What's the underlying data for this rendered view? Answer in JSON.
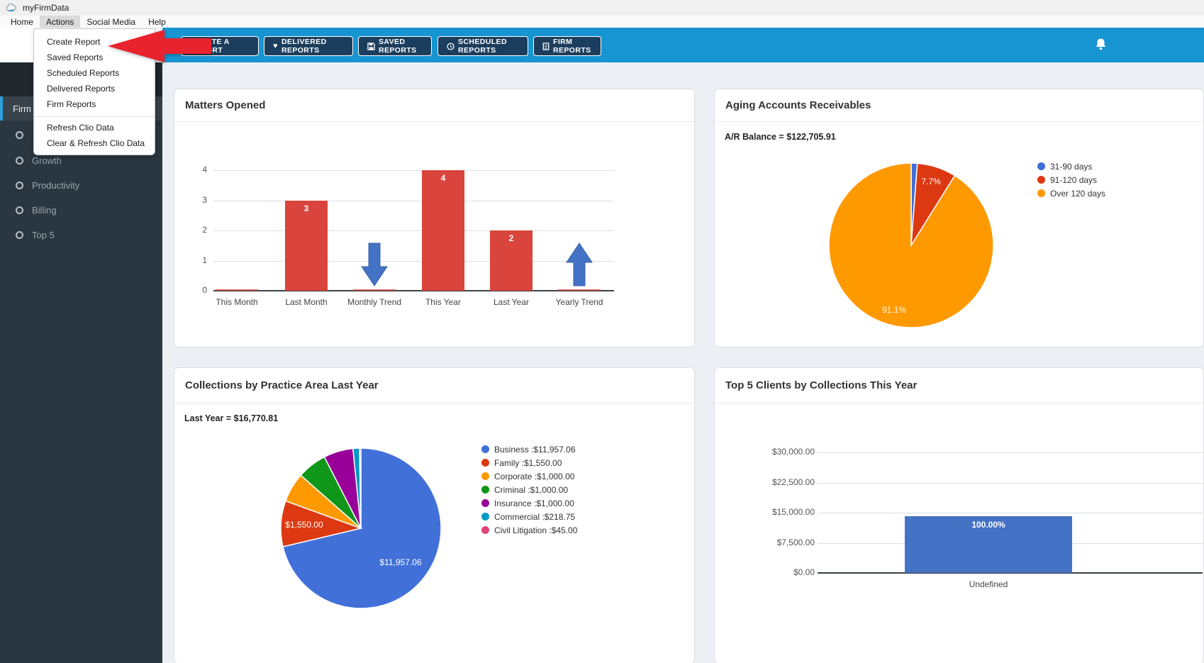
{
  "window": {
    "title": "myFirmData"
  },
  "menubar": {
    "items": [
      "Home",
      "Actions",
      "Social Media",
      "Help"
    ],
    "active": "Actions"
  },
  "actions_menu": {
    "primary": [
      "Create Report",
      "Saved Reports",
      "Scheduled Reports",
      "Delivered Reports",
      "Firm Reports"
    ],
    "secondary": [
      "Refresh Clio Data",
      "Clear & Refresh Clio Data"
    ]
  },
  "toolbar": {
    "buttons": [
      {
        "icon": "",
        "label": "CREATE A REPORT"
      },
      {
        "icon": "heart",
        "label": "DELIVERED REPORTS"
      },
      {
        "icon": "save",
        "label": "SAVED REPORTS"
      },
      {
        "icon": "clock",
        "label": "SCHEDULED REPORTS"
      },
      {
        "icon": "report",
        "label": "FIRM REPORTS"
      }
    ]
  },
  "sidebar": {
    "section": "Firm",
    "items": [
      {
        "label": ""
      },
      {
        "label": "Growth"
      },
      {
        "label": "Productivity"
      },
      {
        "label": "Billing"
      },
      {
        "label": "Top 5"
      }
    ]
  },
  "cards": {
    "matters": {
      "title": "Matters Opened"
    },
    "aging": {
      "title": "Aging Accounts Receivables",
      "subtitle": "A/R Balance = $122,705.91"
    },
    "collections": {
      "title": "Collections by Practice Area Last Year",
      "subtitle": "Last Year = $16,770.81"
    },
    "top5": {
      "title": "Top 5 Clients by Collections This Year"
    }
  },
  "colors": {
    "toolbar_blue": "#1795d2",
    "button_navy": "#1c3e5e",
    "bar_red": "#d9453c",
    "trend_arrow_blue": "#4472c4",
    "sidebar_accent": "#2d9ed8"
  },
  "chart_data": [
    {
      "id": "matters_opened",
      "type": "bar",
      "title": "Matters Opened",
      "categories": [
        "This Month",
        "Last Month",
        "Monthly Trend",
        "This Year",
        "Last Year",
        "Yearly Trend"
      ],
      "values": [
        0,
        3,
        null,
        4,
        2,
        null
      ],
      "bar_labels": [
        "",
        "3",
        "",
        "4",
        "2",
        ""
      ],
      "trend_markers": [
        {
          "category": "Monthly Trend",
          "direction": "down"
        },
        {
          "category": "Yearly Trend",
          "direction": "up"
        }
      ],
      "yticks": [
        0,
        1,
        2,
        3,
        4
      ],
      "ylim": [
        0,
        4
      ],
      "grid": true,
      "bar_color": "#d9453c",
      "arrow_color": "#4472c4",
      "legend_position": "none"
    },
    {
      "id": "aging_accounts_receivables",
      "type": "pie",
      "title": "Aging Accounts Receivables",
      "subtitle": "A/R Balance = $122,705.91",
      "start_angle_deg": 0,
      "direction": "clockwise",
      "legend_position": "right",
      "slices": [
        {
          "label": "31-90 days",
          "percent": 1.2,
          "color": "#3f6ed8",
          "data_label": ""
        },
        {
          "label": "91-120 days",
          "percent": 7.7,
          "color": "#dc3912",
          "data_label": "7.7%"
        },
        {
          "label": "Over 120 days",
          "percent": 91.1,
          "color": "#ff9900",
          "data_label": "91.1%"
        }
      ]
    },
    {
      "id": "collections_by_practice_area",
      "type": "pie",
      "title": "Collections by Practice Area Last Year",
      "subtitle": "Last Year = $16,770.81",
      "total": 16770.81,
      "start_angle_deg": 0,
      "direction": "clockwise",
      "legend_position": "right",
      "slices": [
        {
          "label": "Business",
          "value": 11957.06,
          "percent": 71.3,
          "color": "#4170d8",
          "data_label": "$11,957.06"
        },
        {
          "label": "Family",
          "value": 1550.0,
          "percent": 9.24,
          "color": "#dc3912",
          "data_label": "$1,550.00"
        },
        {
          "label": "Corporate",
          "value": 1000.0,
          "percent": 5.96,
          "color": "#ff9900",
          "data_label": ""
        },
        {
          "label": "Criminal",
          "value": 1000.0,
          "percent": 5.96,
          "color": "#109618",
          "data_label": ""
        },
        {
          "label": "Insurance",
          "value": 1000.0,
          "percent": 5.96,
          "color": "#990099",
          "data_label": ""
        },
        {
          "label": "Commercial",
          "value": 218.75,
          "percent": 1.3,
          "color": "#0099c6",
          "data_label": ""
        },
        {
          "label": "Civil Litigation",
          "value": 45.0,
          "percent": 0.27,
          "color": "#dd4477",
          "data_label": ""
        }
      ],
      "legend_entries": [
        "Business :$11,957.06",
        "Family :$1,550.00",
        "Corporate :$1,000.00",
        "Criminal :$1,000.00",
        "Insurance :$1,000.00",
        "Commercial :$218.75",
        "Civil Litigation :$45.00"
      ]
    },
    {
      "id": "top5_clients_collections",
      "type": "bar",
      "title": "Top 5 Clients by Collections This Year",
      "categories": [
        "Undefined"
      ],
      "values": [
        14200
      ],
      "bar_labels": [
        "100.00%"
      ],
      "yticks": [
        0,
        7500,
        15000,
        22500,
        30000
      ],
      "ytick_labels": [
        "$0.00",
        "$7,500.00",
        "$15,000.00",
        "$22,500.00",
        "$30,000.00"
      ],
      "ylim": [
        0,
        30000
      ],
      "grid": true,
      "bar_color": "#4472c4",
      "legend_position": "none"
    }
  ]
}
